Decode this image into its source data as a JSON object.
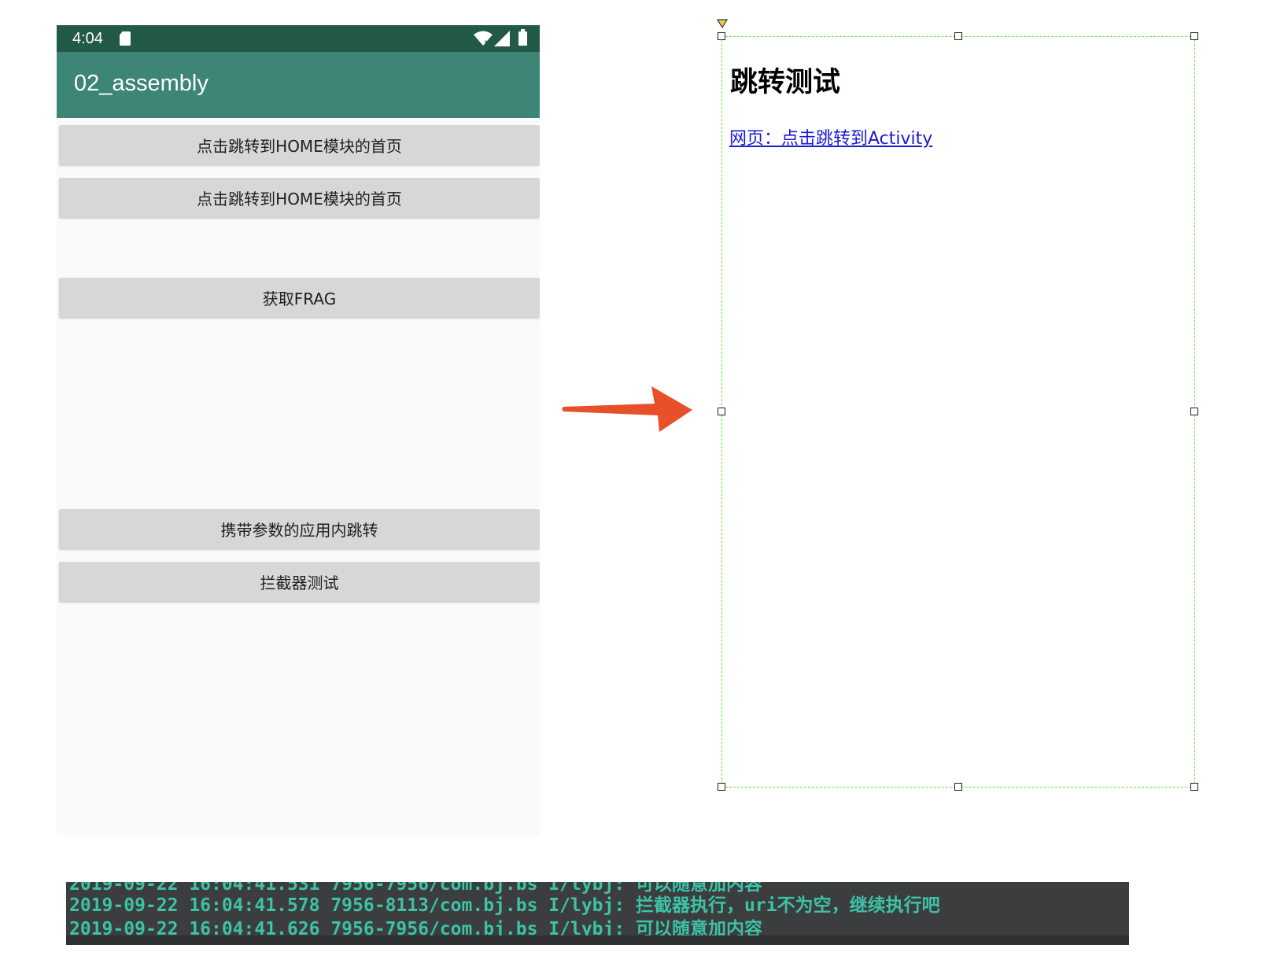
{
  "phone": {
    "status_time": "4:04",
    "app_title": "02_assembly",
    "buttons": [
      "点击跳转到HOME模块的首页",
      "点击跳转到HOME模块的首页",
      "获取FRAG",
      "携带参数的应用内跳转",
      "拦截器测试"
    ],
    "colors": {
      "status_bar": "#235948",
      "app_bar": "#3d8576",
      "button": "#d6d7d7",
      "background": "#fafafa"
    }
  },
  "arrow": {
    "icon": "right-arrow-icon",
    "color": "#e8502a"
  },
  "web": {
    "title": "跳转测试",
    "link_text": "网页：点击跳转到Activity",
    "link_color": "#1a1ad6",
    "frame_color": "#66dd44"
  },
  "log": {
    "lines": [
      "2019-09-22 16:04:41.578 7956-8113/com.bj.bs I/lybj: 拦截器执行，uri不为空，继续执行吧",
      "2019-09-22 16:04:41.626 7956-7956/com.bj.bs I/lybj: 可以随意加内容"
    ],
    "text_color": "#3cc2a6",
    "background": "#3b3d3e"
  }
}
